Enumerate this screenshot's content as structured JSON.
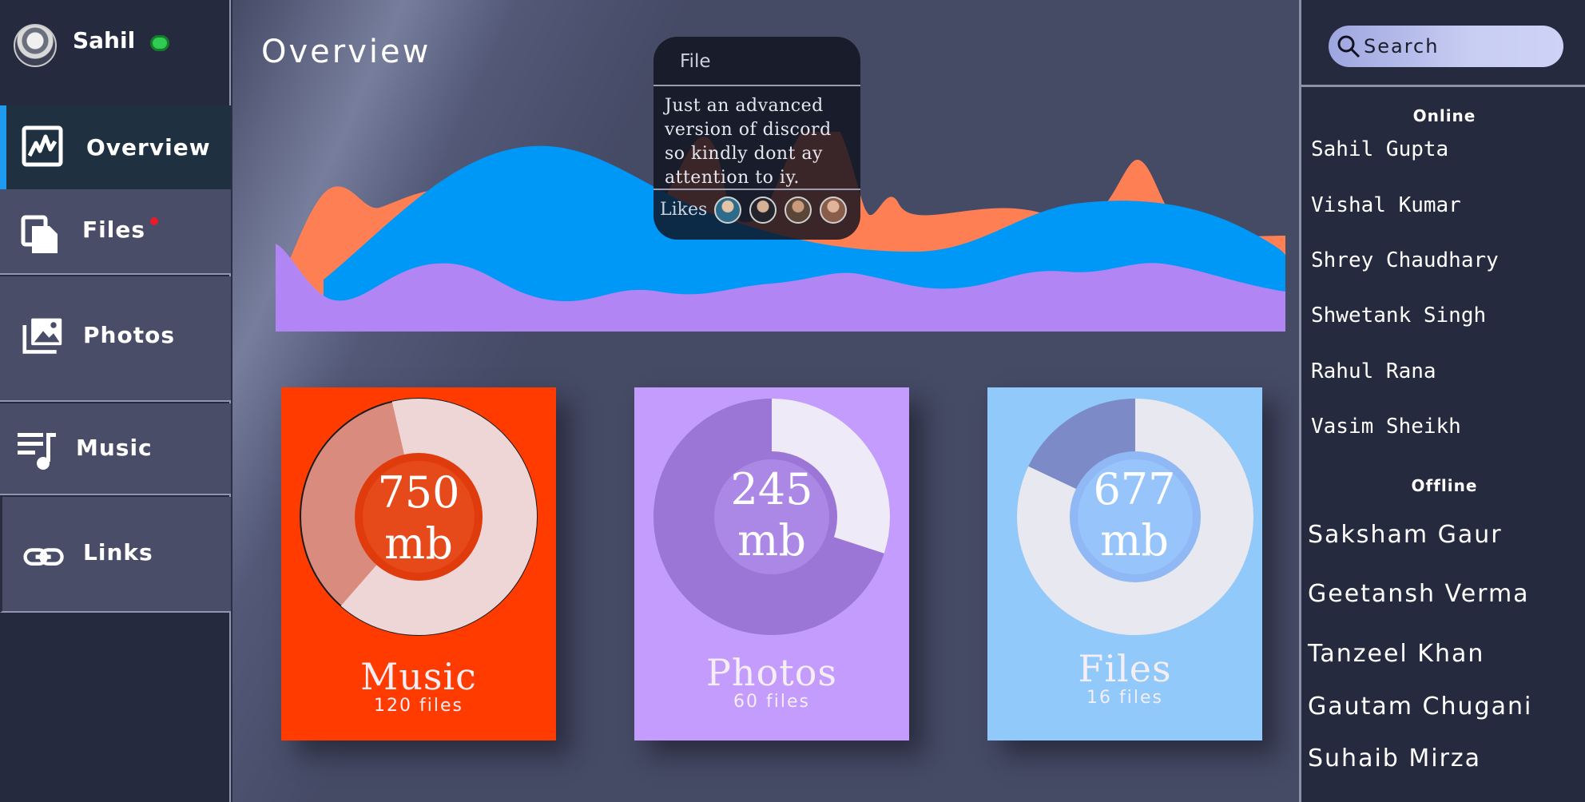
{
  "profile": {
    "name": "Sahil",
    "status_color": "#2ecc50"
  },
  "nav": {
    "items": [
      {
        "label": "Overview",
        "icon": "activity-chart-icon",
        "active": true
      },
      {
        "label": "Files",
        "icon": "files-icon",
        "has_notification": true
      },
      {
        "label": "Photos",
        "icon": "photos-icon"
      },
      {
        "label": "Music",
        "icon": "music-playlist-icon"
      },
      {
        "label": "Links",
        "icon": "link-icon"
      }
    ]
  },
  "main": {
    "title": "Overview",
    "file_card": {
      "title": "File",
      "text": "Just an advanced version of discord so kindly dont ay attention to iy.",
      "likes_label": "Likes",
      "like_avatars": [
        "avatar-1",
        "avatar-2",
        "avatar-3",
        "avatar-4"
      ]
    },
    "stats": [
      {
        "value": "750",
        "unit": "mb",
        "name": "Music",
        "count": "120 files",
        "fraction": 0.65,
        "color": "#ff3b00"
      },
      {
        "value": "245",
        "unit": "mb",
        "name": "Photos",
        "count": "60 files",
        "fraction": 0.3,
        "color": "#c39cfd"
      },
      {
        "value": "677",
        "unit": "mb",
        "name": "Files",
        "count": "16 files",
        "fraction": 0.82,
        "color": "#91c9fb"
      }
    ],
    "colors": {
      "orange": "#ff7f55",
      "blue": "#0098f6",
      "purple": "#b186f4"
    }
  },
  "rightbar": {
    "search": {
      "placeholder": "Search"
    },
    "online_heading": "Online",
    "online": [
      "Sahil Gupta",
      "Vishal Kumar",
      "Shrey Chaudhary",
      "Shwetank Singh",
      "Rahul Rana",
      "Vasim Sheikh"
    ],
    "offline_heading": "Offline",
    "offline": [
      "Saksham Gaur",
      "Geetansh Verma",
      "Tanzeel Khan",
      "Gautam Chugani",
      "Suhaib Mirza"
    ]
  }
}
